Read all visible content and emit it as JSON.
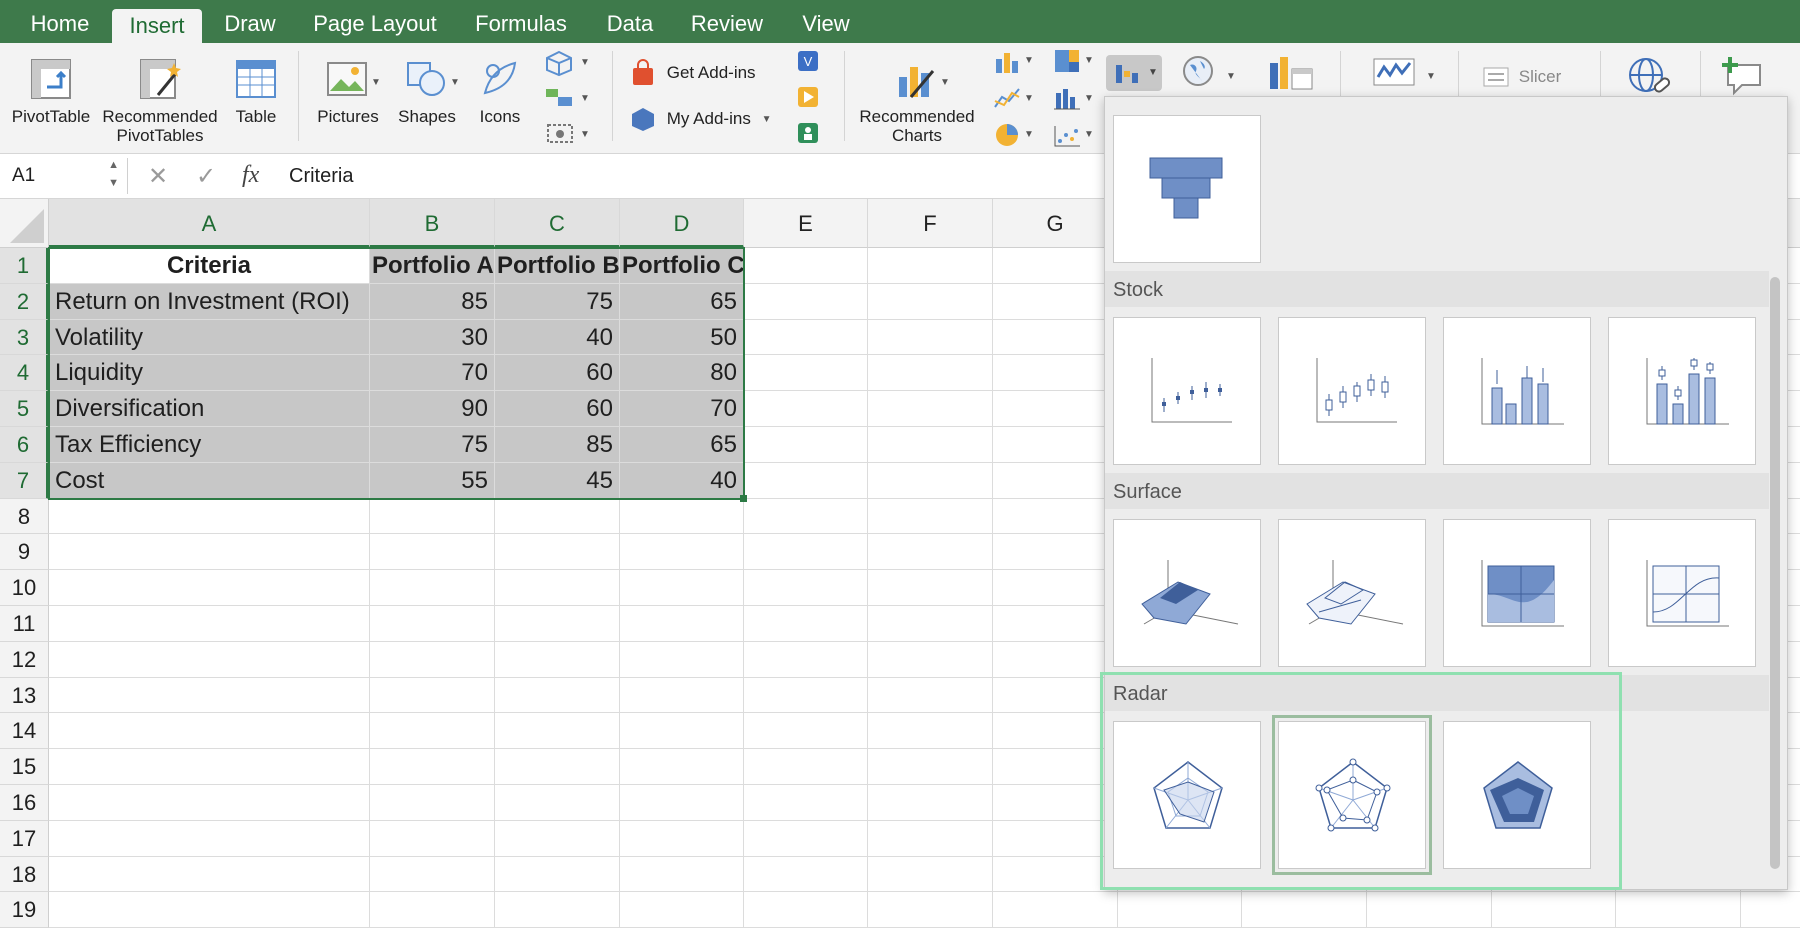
{
  "ribbon_tabs": [
    "Home",
    "Insert",
    "Draw",
    "Page Layout",
    "Formulas",
    "Data",
    "Review",
    "View"
  ],
  "active_tab": "Insert",
  "ribbon": {
    "pivottable": "PivotTable",
    "recommended_pivot_1": "Recommended",
    "recommended_pivot_2": "PivotTables",
    "table": "Table",
    "pictures": "Pictures",
    "shapes": "Shapes",
    "icons": "Icons",
    "get_addins": "Get Add-ins",
    "my_addins": "My Add-ins",
    "recommended_charts_1": "Recommended",
    "recommended_charts_2": "Charts",
    "slicer": "Slicer"
  },
  "formula_bar": {
    "name_box": "A1",
    "fx": "fx",
    "content": "Criteria"
  },
  "columns": [
    "A",
    "B",
    "C",
    "D",
    "E",
    "F",
    "G"
  ],
  "rows": [
    "1",
    "2",
    "3",
    "4",
    "5",
    "6",
    "7",
    "8",
    "9",
    "10",
    "11",
    "12",
    "13",
    "14",
    "15",
    "16",
    "17",
    "18",
    "19"
  ],
  "table": {
    "headers": [
      "Criteria",
      "Portfolio A",
      "Portfolio B",
      "Portfolio C"
    ],
    "rows": [
      [
        "Return on Investment (ROI)",
        "85",
        "75",
        "65"
      ],
      [
        "Volatility",
        "30",
        "40",
        "50"
      ],
      [
        "Liquidity",
        "70",
        "60",
        "80"
      ],
      [
        "Diversification",
        "90",
        "60",
        "70"
      ],
      [
        "Tax Efficiency",
        "75",
        "85",
        "65"
      ],
      [
        "Cost",
        "55",
        "45",
        "40"
      ]
    ]
  },
  "gallery": {
    "sections": {
      "stock": "Stock",
      "surface": "Surface",
      "radar": "Radar"
    }
  },
  "colors": {
    "accent_green": "#3e7a4b",
    "selection_green": "#2d7a45",
    "chart_blue": "#6f8fc6",
    "highlight_frame": "#8fe0b0"
  }
}
